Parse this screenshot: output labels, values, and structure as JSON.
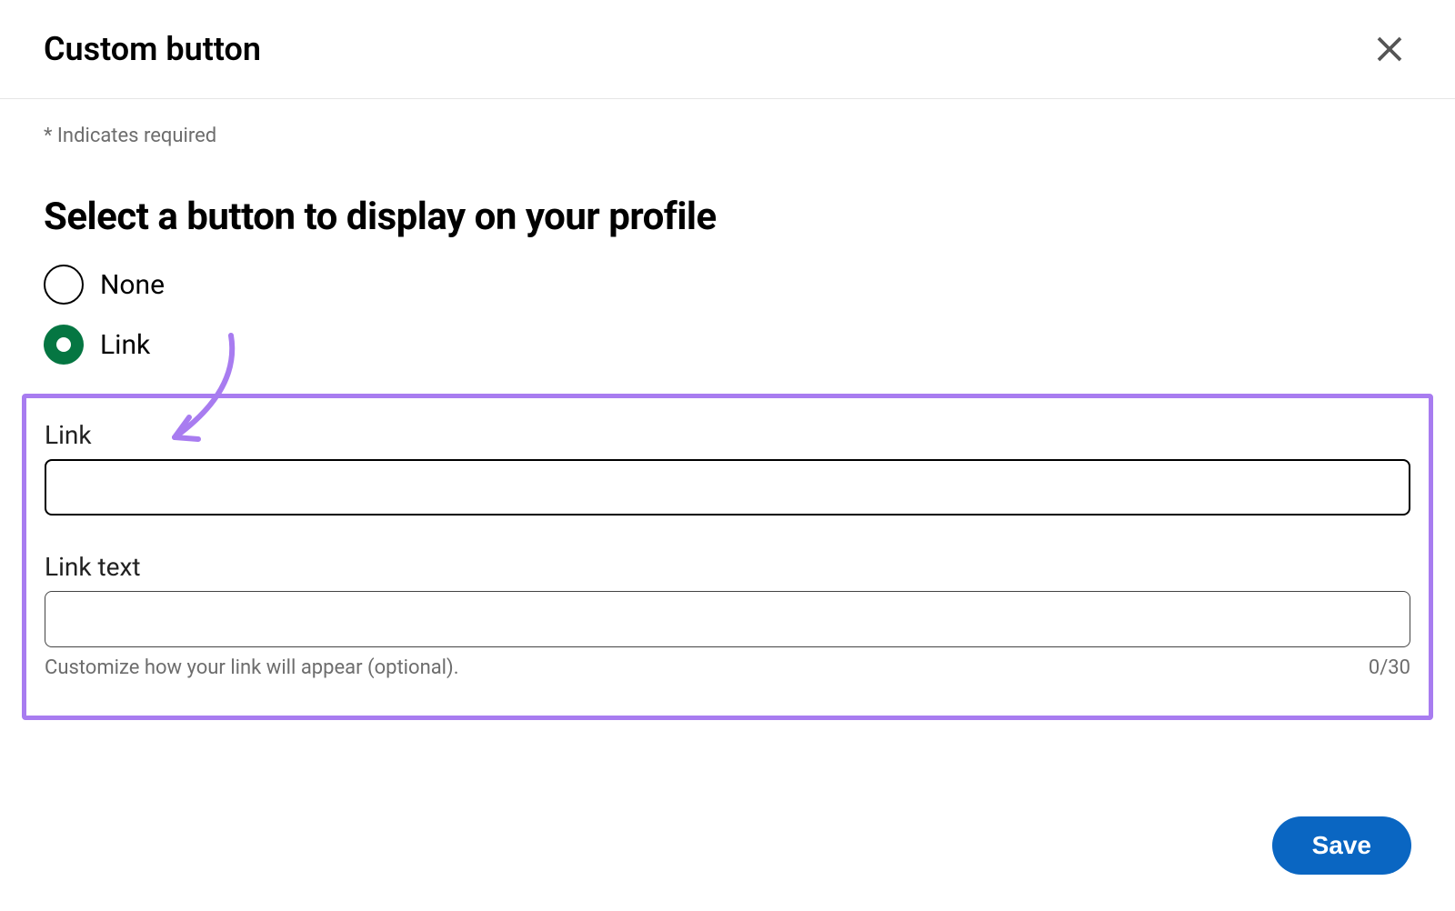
{
  "header": {
    "title": "Custom button"
  },
  "body": {
    "required_note": "* Indicates required",
    "section_heading": "Select a button to display on your profile",
    "radios": {
      "none_label": "None",
      "link_label": "Link"
    },
    "link_field": {
      "label": "Link",
      "value": ""
    },
    "link_text_field": {
      "label": "Link text",
      "value": "",
      "helper": "Customize how your link will appear (optional).",
      "counter": "0/30"
    }
  },
  "footer": {
    "save_label": "Save"
  }
}
